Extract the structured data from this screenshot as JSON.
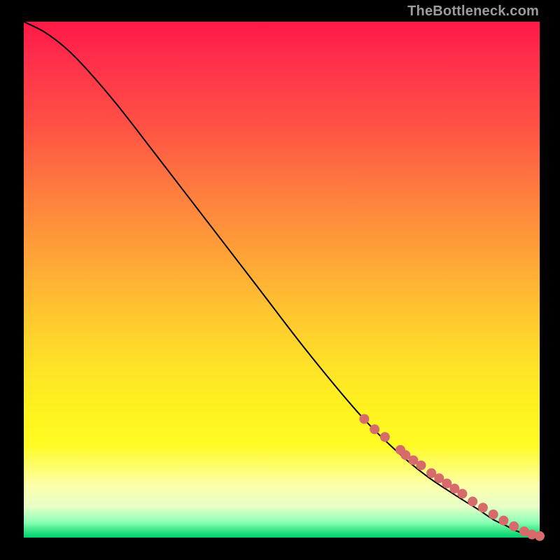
{
  "watermark": "TheBottleneck.com",
  "colors": {
    "curve_stroke": "#000000",
    "marker_fill": "#d76b6b",
    "marker_stroke": "#c45a5a"
  },
  "chart_data": {
    "type": "line",
    "title": "",
    "xlabel": "",
    "ylabel": "",
    "xlim": [
      0,
      100
    ],
    "ylim": [
      0,
      100
    ],
    "series": [
      {
        "name": "curve",
        "x": [
          0,
          4,
          8,
          12,
          18,
          25,
          35,
          45,
          55,
          65,
          72,
          78,
          84,
          88,
          91,
          93.5,
          95,
          96.3,
          97.3,
          98.2,
          98.8,
          99.2,
          100
        ],
        "y": [
          100,
          98,
          95,
          91,
          84,
          75,
          62,
          49,
          36,
          24,
          17,
          12,
          8,
          5.5,
          3.5,
          2.3,
          1.5,
          1.0,
          0.7,
          0.45,
          0.3,
          0.22,
          0.2
        ]
      }
    ],
    "markers": {
      "name": "highlighted-points",
      "x": [
        66,
        68,
        70,
        73,
        74,
        75.5,
        77,
        79,
        80.5,
        82,
        83.5,
        85,
        87,
        89,
        91,
        93,
        95,
        97,
        98.5,
        100
      ],
      "y": [
        23,
        21,
        19.5,
        17,
        16,
        15,
        14,
        12.5,
        11.5,
        10.5,
        9.5,
        8.5,
        7,
        5.8,
        4.5,
        3.3,
        2.2,
        1.2,
        0.6,
        0.3
      ]
    }
  }
}
